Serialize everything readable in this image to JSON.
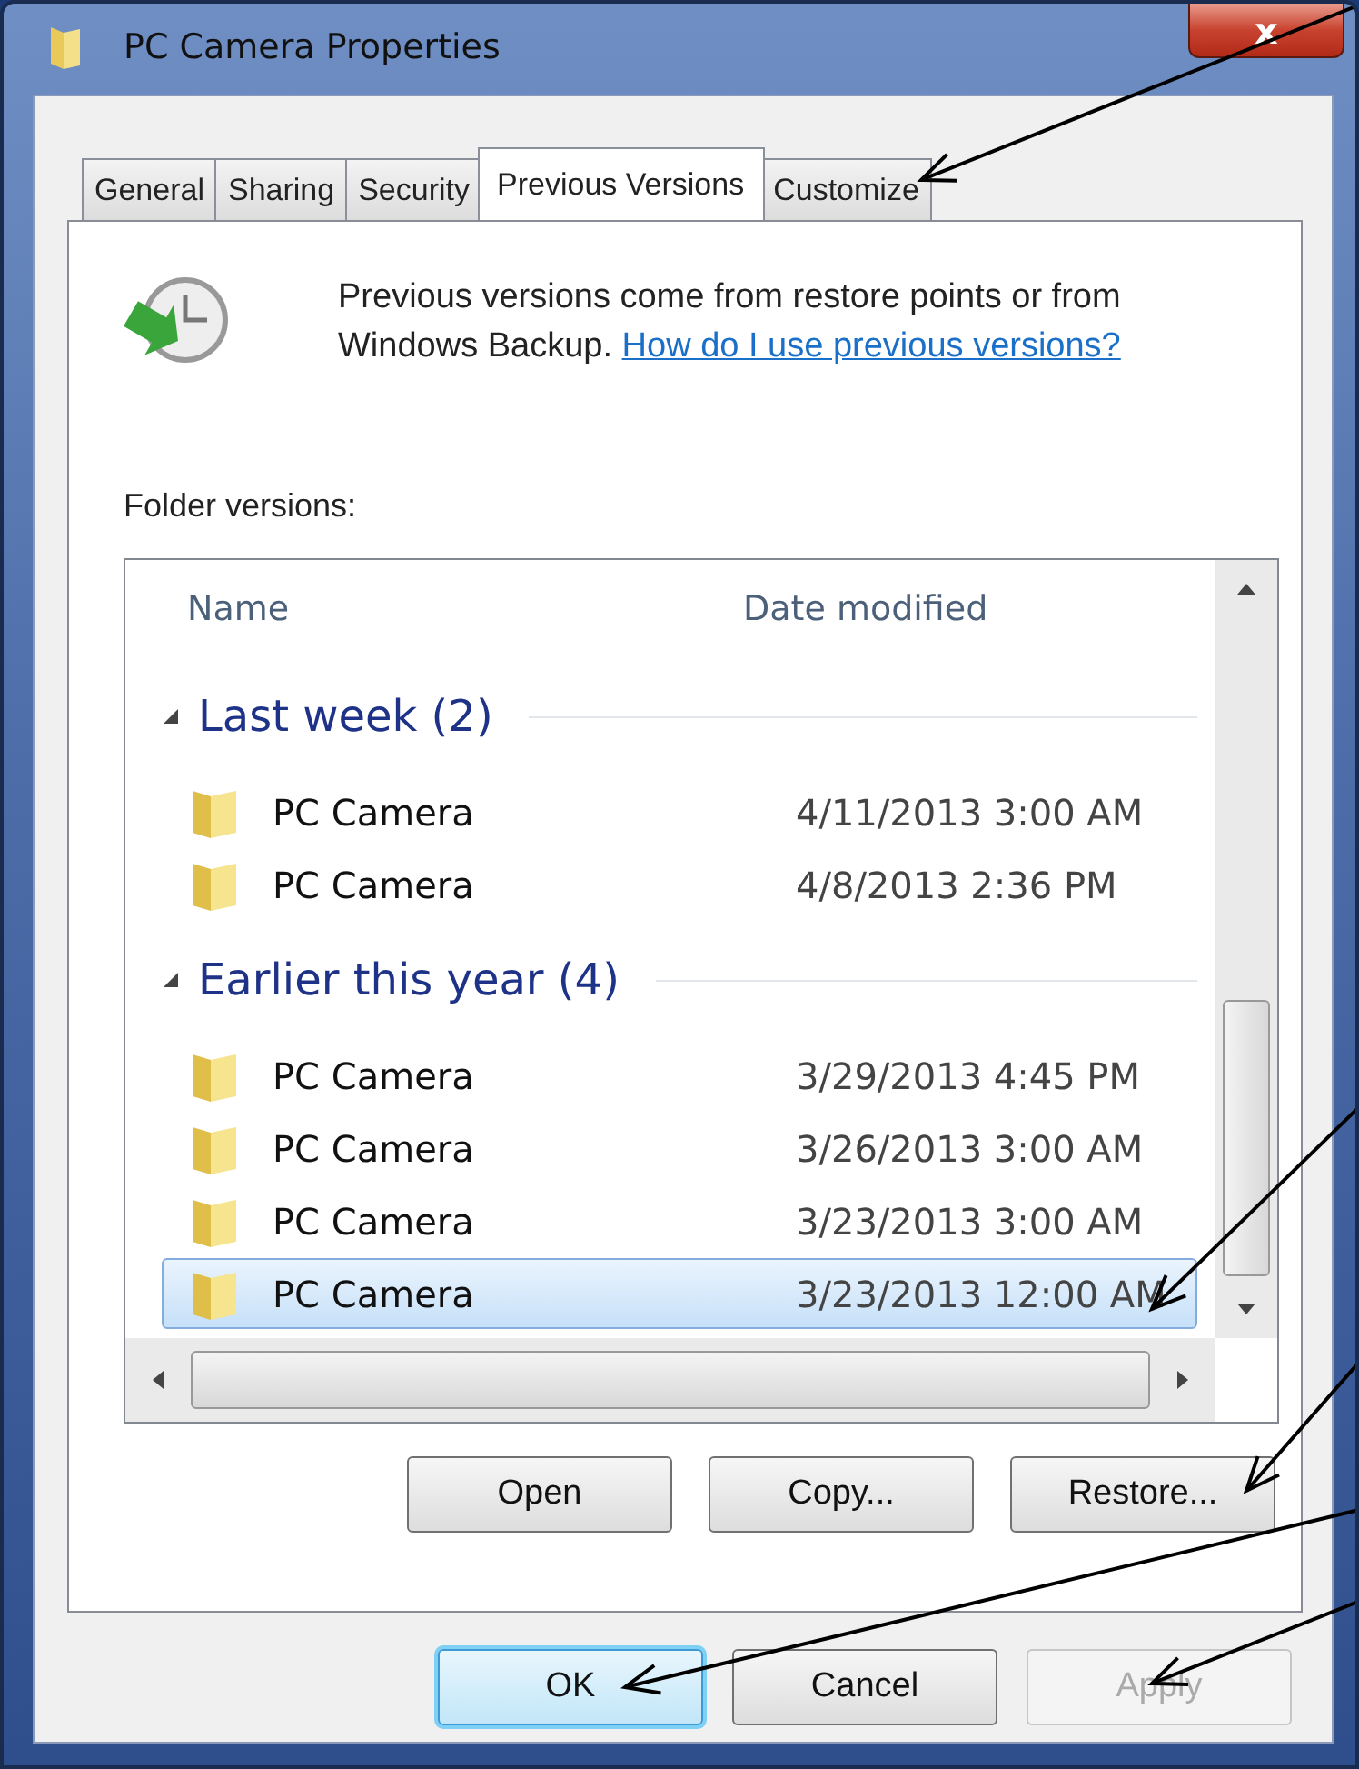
{
  "window": {
    "title": "PC Camera Properties",
    "close": "x"
  },
  "tabs": [
    {
      "label": "General",
      "selected": false
    },
    {
      "label": "Sharing",
      "selected": false
    },
    {
      "label": "Security",
      "selected": false
    },
    {
      "label": "Previous Versions",
      "selected": true
    },
    {
      "label": "Customize",
      "selected": false
    }
  ],
  "info": {
    "text": "Previous versions come from restore points or from Windows Backup.",
    "link": "How do I use previous versions?"
  },
  "versions_label": "Folder versions:",
  "columns": [
    "Name",
    "Date modified"
  ],
  "groups": [
    {
      "title": "Last week (2)",
      "expanded": true,
      "items": [
        {
          "name": "PC Camera",
          "date": "4/11/2013 3:00 AM",
          "selected": false
        },
        {
          "name": "PC Camera",
          "date": "4/8/2013 2:36 PM",
          "selected": false
        }
      ]
    },
    {
      "title": "Earlier this year (4)",
      "expanded": true,
      "items": [
        {
          "name": "PC Camera",
          "date": "3/29/2013 4:45 PM",
          "selected": false
        },
        {
          "name": "PC Camera",
          "date": "3/26/2013 3:00 AM",
          "selected": false
        },
        {
          "name": "PC Camera",
          "date": "3/23/2013 3:00 AM",
          "selected": false
        },
        {
          "name": "PC Camera",
          "date": "3/23/2013 12:00 AM",
          "selected": true
        }
      ]
    }
  ],
  "version_buttons": [
    "Open",
    "Copy...",
    "Restore..."
  ],
  "dialog_buttons": [
    {
      "label": "OK",
      "default": true,
      "disabled": false
    },
    {
      "label": "Cancel",
      "default": false,
      "disabled": false
    },
    {
      "label": "Apply",
      "default": false,
      "disabled": true
    }
  ]
}
